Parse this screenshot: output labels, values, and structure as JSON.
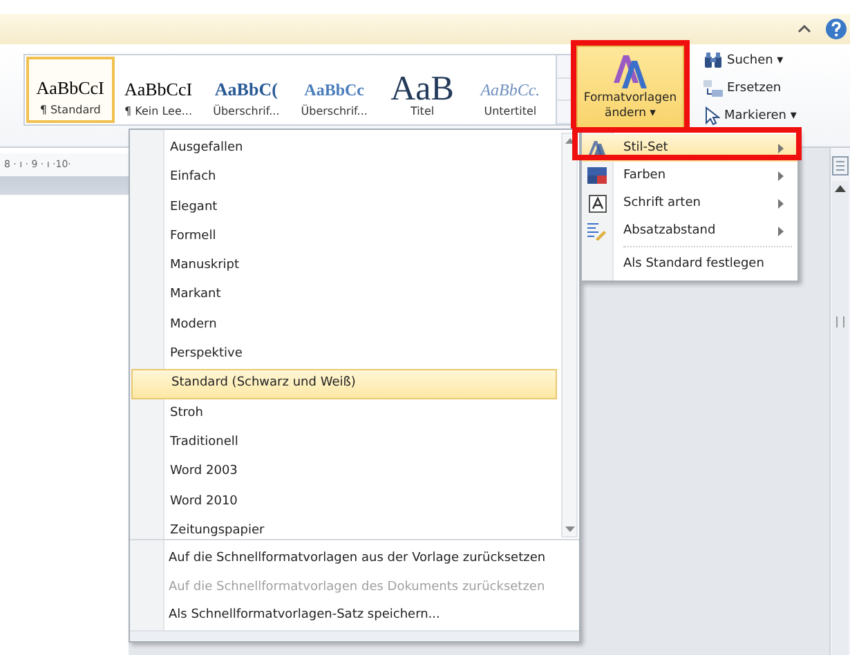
{
  "styles_gallery": {
    "items": [
      {
        "sample": "AaBbCcI",
        "label": "¶ Standard",
        "kind": "normal",
        "selected": true
      },
      {
        "sample": "AaBbCcI",
        "label": "¶ Kein Lee...",
        "kind": "normal",
        "selected": false
      },
      {
        "sample": "AaBbC(",
        "label": "Überschrif...",
        "kind": "heading1",
        "selected": false
      },
      {
        "sample": "AaBbCc",
        "label": "Überschrif...",
        "kind": "heading2",
        "selected": false
      },
      {
        "sample": "AaB",
        "label": "Titel",
        "kind": "title",
        "selected": false
      },
      {
        "sample": "AaBbCc.",
        "label": "Untertitel",
        "kind": "subtitle",
        "selected": false
      }
    ]
  },
  "change_styles_button": {
    "label_lines": [
      "Formatvorlagen",
      "ändern ▾"
    ]
  },
  "editing": [
    {
      "label": "Suchen ▾",
      "kind": "find"
    },
    {
      "label": "Ersetzen",
      "kind": "replace"
    },
    {
      "label": "Markieren ▾",
      "kind": "select"
    }
  ],
  "ruler": {
    "text": "8 · ı · 9 · ı ·10·"
  },
  "style_set_menu": {
    "items": [
      {
        "label": "Ausgefallen",
        "selected": false
      },
      {
        "label": "Einfach",
        "selected": false
      },
      {
        "label": "Elegant",
        "selected": false
      },
      {
        "label": "Formell",
        "selected": false
      },
      {
        "label": "Manuskript",
        "selected": false
      },
      {
        "label": "Markant",
        "selected": false
      },
      {
        "label": "Modern",
        "selected": false
      },
      {
        "label": "Perspektive",
        "selected": false
      },
      {
        "label": "Standard (Schwarz und Weiß)",
        "selected": true
      },
      {
        "label": "Stroh",
        "selected": false
      },
      {
        "label": "Traditionell",
        "selected": false
      },
      {
        "label": "Word 2003",
        "selected": false
      },
      {
        "label": "Word 2010",
        "selected": false
      },
      {
        "label": "Zeitungspapier",
        "selected": false
      }
    ],
    "commands": [
      {
        "label": "Auf die Schnellformatvorlagen aus der Vorlage zurücksetzen",
        "disabled": false
      },
      {
        "label": "Auf die Schnellformatvorlagen des Dokuments zurücksetzen",
        "disabled": true
      },
      {
        "label": "Als Schnellformatvorlagen-Satz speichern...",
        "disabled": false
      }
    ]
  },
  "change_styles_menu": {
    "items": [
      {
        "label": "Stil-Set",
        "kind": "styleset",
        "submenu": true,
        "selected": true
      },
      {
        "label": "Farben",
        "kind": "colors",
        "submenu": true,
        "selected": false
      },
      {
        "label": "Schrift arten",
        "kind": "fonts",
        "submenu": true,
        "selected": false
      },
      {
        "label": "Absatzabstand",
        "kind": "spacing",
        "submenu": true,
        "selected": false
      },
      {
        "label": "Als Standard festlegen",
        "kind": "default",
        "submenu": false,
        "selected": false
      }
    ]
  }
}
